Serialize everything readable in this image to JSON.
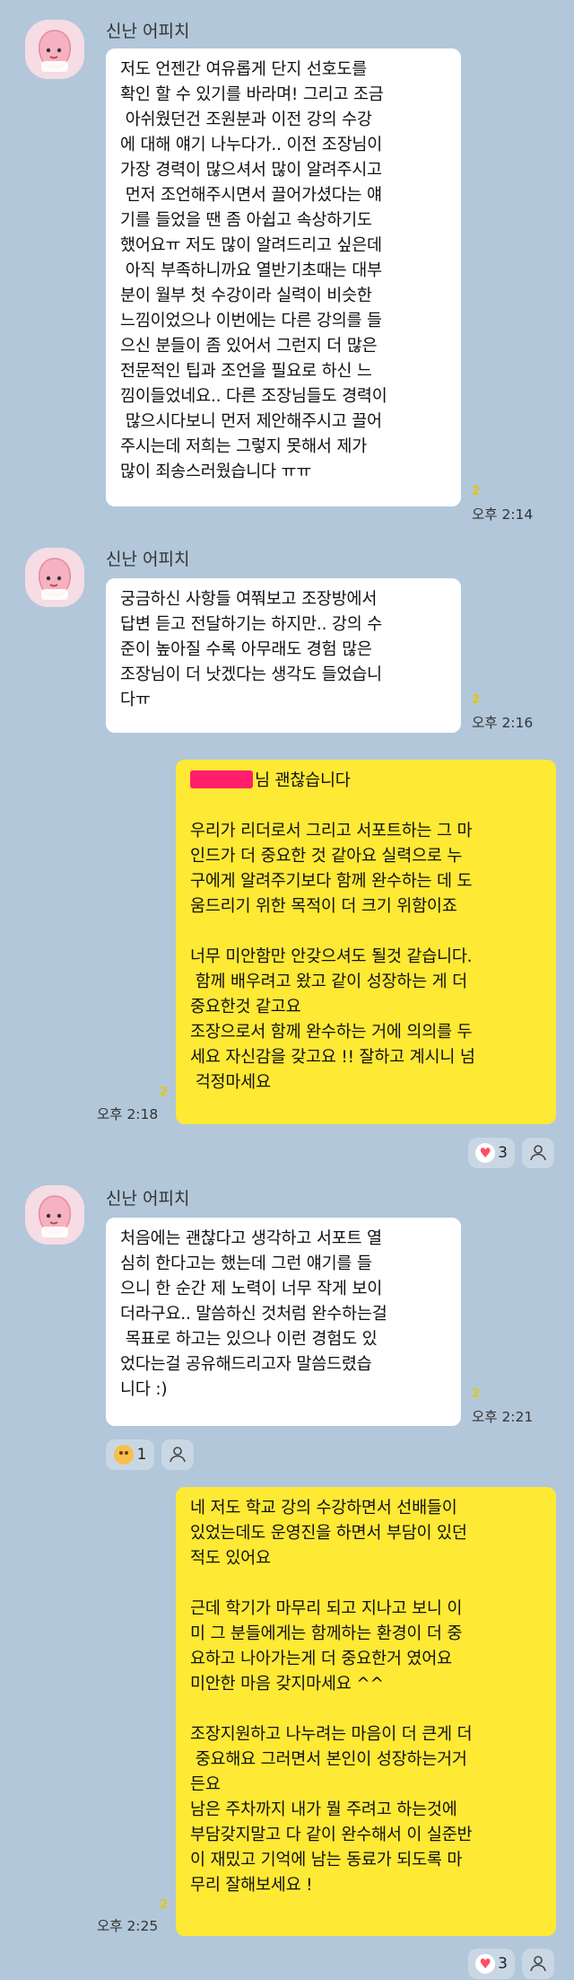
{
  "sender_name": "신난 어피치",
  "messages": [
    {
      "text": "저도 언젠간 여유롭게 단지 선호도를\n확인 할 수 있기를 바라며! 그리고 조금\n 아쉬웠던건 조원분과 이전 강의 수강\n에 대해 얘기 나누다가.. 이전 조장님이\n가장 경력이 많으셔서 많이 알려주시고\n 먼저 조언해주시면서 끌어가셨다는 얘\n기를 들었을 땐 좀 아쉽고 속상하기도\n했어요ㅠ 저도 많이 알려드리고 싶은데\n 아직 부족하니까요 열반기초때는 대부\n분이 월부 첫 수강이라 실력이 비슷한\n느낌이었으나 이번에는 다른 강의를 들\n으신 분들이 좀 있어서 그런지 더 많은\n전문적인 팁과 조언을 필요로 하신 느\n낌이들었네요.. 다른 조장님들도 경력이\n 많으시다보니 먼저 제안해주시고 끌어\n주시는데 저희는 그렇지 못해서 제가\n많이 죄송스러웠습니다 ㅠㅠ",
      "unread": "2",
      "time": "오후 2:14"
    },
    {
      "text": "궁금하신 사항들 여쭤보고 조장방에서\n답변 듣고 전달하기는 하지만.. 강의 수\n준이 높아질 수록 아무래도 경험 많은\n조장님이 더 낫겠다는 생각도 들었습니\n다ㅠ",
      "unread": "2",
      "time": "오후 2:16"
    },
    {
      "text_after_redaction": "님 괜찮습니다\n\n우리가 리더로서 그리고 서포트하는 그 마\n인드가 더 중요한 것 같아요 실력으로 누\n구에게 알려주기보다 함께 완수하는 데 도\n움드리기 위한 목적이 더 크기 위함이죠\n\n너무 미안함만 안갖으셔도 될것 같습니다.\n 함께 배우려고 왔고 같이 성장하는 게 더\n중요한것 같고요\n조장으로서 함께 완수하는 거에 의의를 두\n세요 자신감을 갖고요 !! 잘하고 계시니 넘\n 걱정마세요",
      "unread": "2",
      "time": "오후 2:18",
      "reaction_count": "3"
    },
    {
      "text": "처음에는 괜찮다고 생각하고 서포트 열\n심히 한다고는 했는데 그런 얘기를 들\n으니 한 순간 제 노력이 너무 작게 보이\n더라구요.. 말씀하신 것처럼 완수하는걸\n 목표로 하고는 있으나 이런 경험도 있\n었다는걸 공유해드리고자 말씀드렸습\n니다 :)",
      "unread": "2",
      "time": "오후 2:21",
      "reaction_count": "1"
    },
    {
      "text": "네 저도 학교 강의 수강하면서 선배들이\n있었는데도 운영진을 하면서 부담이 있던\n적도 있어요\n\n근데 학기가 마무리 되고 지나고 보니 이\n미 그 분들에게는 함께하는 환경이 더 중\n요하고 나아가는게 더 중요한거 였어요\n미안한 마음 갖지마세요 ^^\n\n조장지원하고 나누려는 마음이 더 큰게 더\n 중요해요 그러면서 본인이 성장하는거거\n든요\n남은 주차까지 내가 뭘 주려고 하는것에\n부담갖지말고 다 같이 완수해서 이 실준반\n이 재밌고 기억에 남는 동료가 되도록 마\n무리 잘해보세요 !",
      "unread": "2",
      "time": "오후 2:25",
      "reaction_count": "3"
    }
  ],
  "colors": {
    "background": "#b2c7da",
    "my_bubble": "#fee934",
    "their_bubble": "#ffffff",
    "unread": "#e2c800",
    "redaction": "#ff1f6b"
  }
}
